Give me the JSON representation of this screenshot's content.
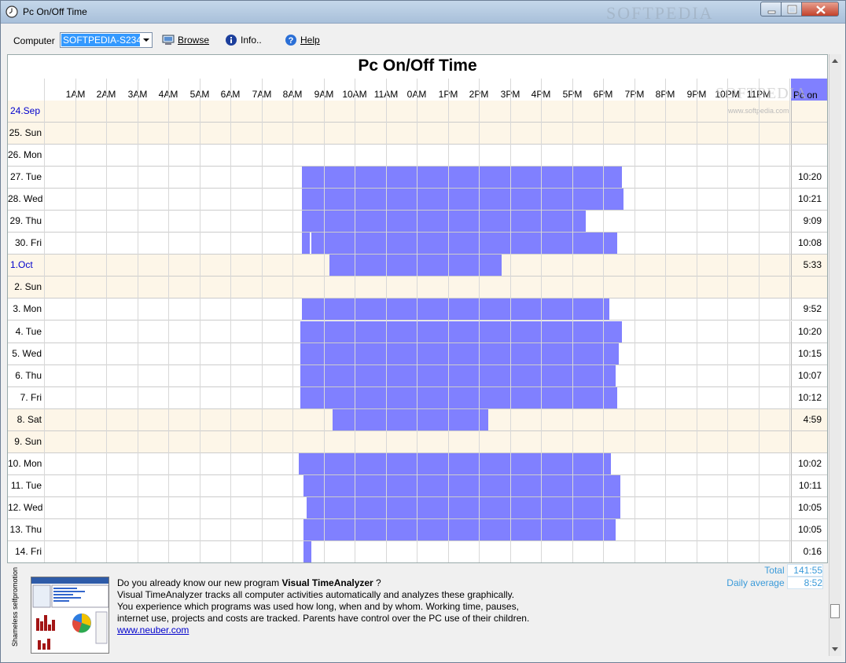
{
  "window": {
    "title": "Pc On/Off Time",
    "watermark": "SOFTPEDIA"
  },
  "toolbar": {
    "computer_label": "Computer",
    "computer_value": "SOFTPEDIA-S234",
    "browse_label": "Browse",
    "info_label": "Info..",
    "help_label": "Help"
  },
  "chart": {
    "title": "Pc On/Off Time",
    "pc_on_header": "Pc on",
    "watermark": "SOFTPEDIA",
    "watermark_url": "www.softpedia.com"
  },
  "chart_data": {
    "type": "table",
    "title": "Pc On/Off Time",
    "hours": [
      "1AM",
      "2AM",
      "3AM",
      "4AM",
      "5AM",
      "6AM",
      "7AM",
      "8AM",
      "9AM",
      "10AM",
      "11AM",
      "0AM",
      "1PM",
      "2PM",
      "3PM",
      "4PM",
      "5PM",
      "6PM",
      "7PM",
      "8PM",
      "9PM",
      "10PM",
      "11PM"
    ],
    "rows": [
      {
        "date": "24.Sep",
        "weekend": true,
        "month_start": true,
        "segments": [],
        "pc_on": ""
      },
      {
        "date": "25. Sun",
        "weekend": true,
        "segments": [],
        "pc_on": ""
      },
      {
        "date": "26. Mon",
        "weekend": false,
        "segments": [],
        "pc_on": ""
      },
      {
        "date": "27. Tue",
        "weekend": false,
        "segments": [
          [
            8.3,
            18.6
          ]
        ],
        "pc_on": "10:20"
      },
      {
        "date": "28. Wed",
        "weekend": false,
        "segments": [
          [
            8.3,
            18.65
          ]
        ],
        "pc_on": "10:21"
      },
      {
        "date": "29. Thu",
        "weekend": false,
        "segments": [
          [
            8.3,
            17.45
          ]
        ],
        "pc_on": "9:09"
      },
      {
        "date": "30. Fri",
        "weekend": false,
        "segments": [
          [
            8.3,
            8.55
          ],
          [
            8.6,
            18.45
          ]
        ],
        "pc_on": "10:08"
      },
      {
        "date": "1.Oct",
        "weekend": true,
        "month_start": true,
        "segments": [
          [
            9.2,
            14.75
          ]
        ],
        "pc_on": "5:33"
      },
      {
        "date": "2. Sun",
        "weekend": true,
        "segments": [],
        "pc_on": ""
      },
      {
        "date": "3. Mon",
        "weekend": false,
        "segments": [
          [
            8.3,
            18.2
          ]
        ],
        "pc_on": "9:52"
      },
      {
        "date": "4. Tue",
        "weekend": false,
        "segments": [
          [
            8.25,
            18.6
          ]
        ],
        "pc_on": "10:20"
      },
      {
        "date": "5. Wed",
        "weekend": false,
        "segments": [
          [
            8.25,
            9.75
          ],
          [
            9.75,
            18.5
          ]
        ],
        "pc_on": "10:15"
      },
      {
        "date": "6. Thu",
        "weekend": false,
        "segments": [
          [
            8.25,
            18.4
          ]
        ],
        "pc_on": "10:07"
      },
      {
        "date": "7. Fri",
        "weekend": false,
        "segments": [
          [
            8.25,
            18.45
          ]
        ],
        "pc_on": "10:12"
      },
      {
        "date": "8. Sat",
        "weekend": true,
        "segments": [
          [
            9.3,
            14.3
          ]
        ],
        "pc_on": "4:59"
      },
      {
        "date": "9. Sun",
        "weekend": true,
        "segments": [],
        "pc_on": ""
      },
      {
        "date": "10. Mon",
        "weekend": false,
        "segments": [
          [
            8.2,
            18.25
          ]
        ],
        "pc_on": "10:02"
      },
      {
        "date": "11. Tue",
        "weekend": false,
        "segments": [
          [
            8.35,
            18.55
          ]
        ],
        "pc_on": "10:11"
      },
      {
        "date": "12. Wed",
        "weekend": false,
        "segments": [
          [
            8.45,
            18.55
          ]
        ],
        "pc_on": "10:05"
      },
      {
        "date": "13. Thu",
        "weekend": false,
        "segments": [
          [
            8.35,
            18.4
          ]
        ],
        "pc_on": "10:05"
      },
      {
        "date": "14. Fri",
        "weekend": false,
        "segments": [
          [
            8.35,
            8.6
          ]
        ],
        "pc_on": "0:16"
      }
    ]
  },
  "promo": {
    "side_label": "Shameless selfpromotion",
    "line1_prefix": "Do you already know our new program ",
    "line1_bold": "Visual TimeAnalyzer",
    "line1_suffix": " ?",
    "line2": "Visual TimeAnalyzer tracks all computer activities automatically and analyzes these graphically.",
    "line3": "You experience which programs was used how long, when and by whom. Working time, pauses,",
    "line4": "internet use, projects and costs are tracked. Parents have control over the PC use of their children.",
    "link": "www.neuber.com"
  },
  "totals": {
    "total_label": "Total",
    "total_value": "141:55",
    "avg_label": "Daily average",
    "avg_value": "8:52"
  },
  "colors": {
    "bar": "#8080ff",
    "weekend": "#fdf6e8",
    "month_label": "#0000cc"
  }
}
